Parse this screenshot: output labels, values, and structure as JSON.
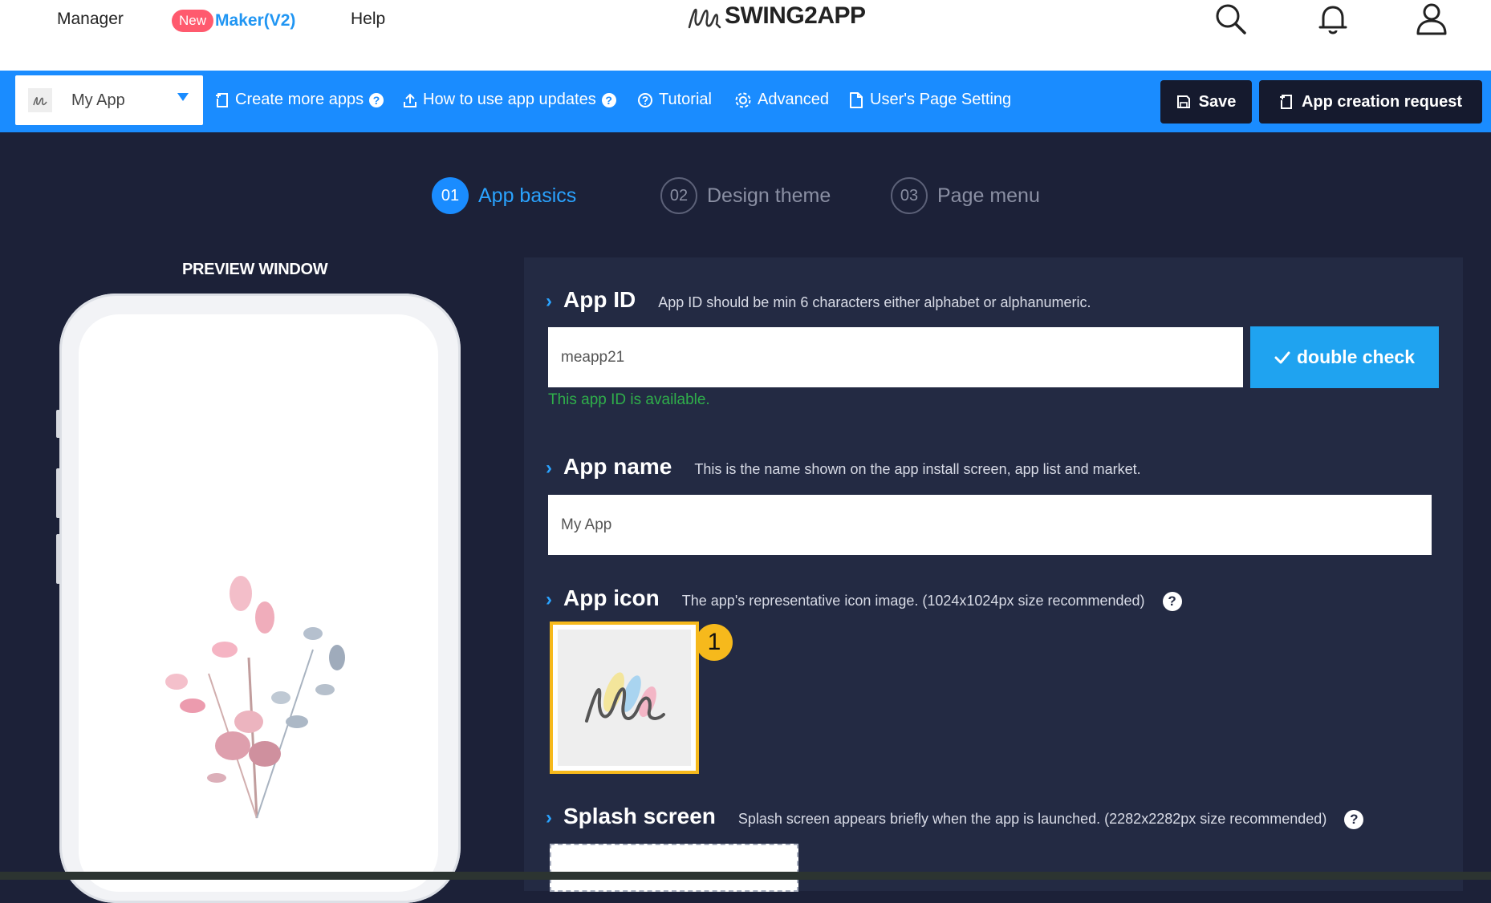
{
  "topnav": {
    "manager": "Manager",
    "new_badge": "New",
    "maker": "Maker(V2)",
    "help": "Help",
    "logo_text": "SWING2APP",
    "icons": [
      "search-icon",
      "bell-icon",
      "user-icon"
    ]
  },
  "toolbar": {
    "app_select_value": "My App",
    "create_more_apps": "Create more apps",
    "how_to_use_updates": "How to use app updates",
    "tutorial": "Tutorial",
    "advanced": "Advanced",
    "users_page_setting": "User's Page Setting",
    "save": "Save",
    "app_creation_request": "App creation request"
  },
  "steps": [
    {
      "num": "01",
      "label": "App basics",
      "active": true
    },
    {
      "num": "02",
      "label": "Design theme",
      "active": false
    },
    {
      "num": "03",
      "label": "Page menu",
      "active": false
    }
  ],
  "preview": {
    "title": "PREVIEW WINDOW"
  },
  "form": {
    "app_id": {
      "label": "App ID",
      "desc": "App ID should be min 6 characters either alphabet or alphanumeric.",
      "value": "meapp21",
      "check_button": "double check",
      "status": "This app ID is available."
    },
    "app_name": {
      "label": "App name",
      "desc": "This is the name shown on the app install screen, app list and market.",
      "value": "My App"
    },
    "app_icon": {
      "label": "App icon",
      "desc": "The app's representative icon image. (1024x1024px size recommended)",
      "badge": "1"
    },
    "splash": {
      "label": "Splash screen",
      "desc": "Splash screen appears briefly when the app is launched. (2282x2282px size recommended)"
    }
  },
  "colors": {
    "accent": "#1a8cff",
    "background": "#1c2138",
    "panel": "#232a43",
    "highlight": "#f6b91c",
    "success": "#2fae4a",
    "badge": "#ff5a6e"
  }
}
